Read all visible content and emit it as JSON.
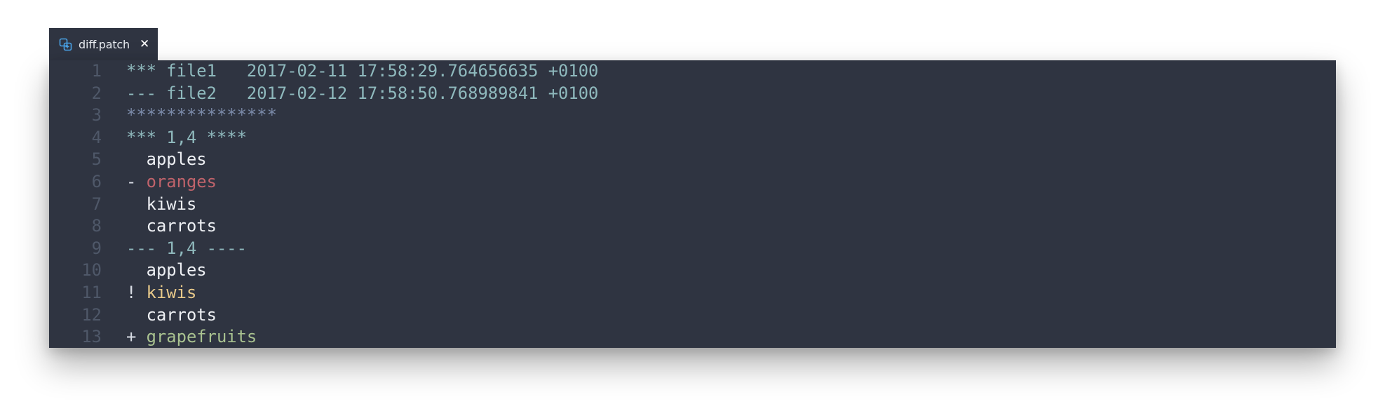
{
  "tab": {
    "title": "diff.patch",
    "close_glyph": "✕",
    "icon": "diff-file-icon"
  },
  "colors": {
    "editor_bg": "#2f3441",
    "line_number": "#4f5869",
    "header": "#8fb9bd",
    "asterisks": "#7a89a7",
    "context": "#eef0f4",
    "deleted": "#c0636b",
    "changed": "#e8c98a",
    "added": "#a9c290"
  },
  "lines": [
    {
      "n": "1",
      "parts": [
        {
          "t": "*** file1   2017-02-11 17:58:29.764656635 +0100",
          "c": "c-head"
        }
      ]
    },
    {
      "n": "2",
      "parts": [
        {
          "t": "--- file2   2017-02-12 17:58:50.768989841 +0100",
          "c": "c-head"
        }
      ]
    },
    {
      "n": "3",
      "parts": [
        {
          "t": "***************",
          "c": "c-star"
        }
      ]
    },
    {
      "n": "4",
      "parts": [
        {
          "t": "*** 1,4 ****",
          "c": "c-head"
        }
      ]
    },
    {
      "n": "5",
      "parts": [
        {
          "t": "  apples",
          "c": "c-norm"
        }
      ]
    },
    {
      "n": "6",
      "parts": [
        {
          "t": "- ",
          "c": "c-mark"
        },
        {
          "t": "oranges",
          "c": "c-del"
        }
      ]
    },
    {
      "n": "7",
      "parts": [
        {
          "t": "  kiwis",
          "c": "c-norm"
        }
      ]
    },
    {
      "n": "8",
      "parts": [
        {
          "t": "  carrots",
          "c": "c-norm"
        }
      ]
    },
    {
      "n": "9",
      "parts": [
        {
          "t": "--- 1,4 ----",
          "c": "c-head"
        }
      ]
    },
    {
      "n": "10",
      "parts": [
        {
          "t": "  apples",
          "c": "c-norm"
        }
      ]
    },
    {
      "n": "11",
      "parts": [
        {
          "t": "! ",
          "c": "c-mark"
        },
        {
          "t": "kiwis",
          "c": "c-mod"
        }
      ]
    },
    {
      "n": "12",
      "parts": [
        {
          "t": "  carrots",
          "c": "c-norm"
        }
      ]
    },
    {
      "n": "13",
      "parts": [
        {
          "t": "+ ",
          "c": "c-mark"
        },
        {
          "t": "grapefruits",
          "c": "c-add"
        }
      ]
    }
  ]
}
